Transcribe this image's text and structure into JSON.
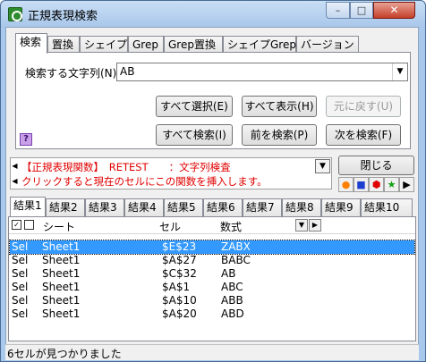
{
  "window": {
    "title": "正規表現検索",
    "minimize_glyph": "–",
    "maximize_glyph": "□",
    "close_glyph": "✕"
  },
  "tabs": [
    "検索",
    "置換",
    "シェイプ",
    "Grep",
    "Grep置換",
    "シェイプGrep",
    "バージョン"
  ],
  "search": {
    "label": "検索する文字列(N)",
    "value": "AB"
  },
  "buttons": {
    "select_all": "すべて選択(E)",
    "show_all": "すべて表示(H)",
    "undo": "元に戻す(U)",
    "search_all": "すべて検索(I)",
    "search_prev": "前を検索(P)",
    "search_next": "次を検索(F)",
    "close": "閉じる"
  },
  "help_icon": "?",
  "function_hint": {
    "line1": "【正規表現関数】　RETEST　　：文字列検査",
    "line2": "クリックすると現在のセルにこの関数を挿入します。"
  },
  "shape_icons": [
    "orange-circle-icon",
    "blue-square-icon",
    "red-hexagon-icon",
    "green-star-icon",
    "play-icon"
  ],
  "result_tabs": [
    "結果1",
    "結果2",
    "結果3",
    "結果4",
    "結果5",
    "結果6",
    "結果7",
    "結果8",
    "結果9",
    "結果10"
  ],
  "results": {
    "columns": [
      "シート",
      "セル",
      "数式"
    ],
    "rows": [
      {
        "sel": "Sel",
        "sheet": "Sheet1",
        "cell": "$E$23",
        "formula": "ZABX"
      },
      {
        "sel": "Sel",
        "sheet": "Sheet1",
        "cell": "$A$27",
        "formula": "BABC"
      },
      {
        "sel": "Sel",
        "sheet": "Sheet1",
        "cell": "$C$32",
        "formula": "AB"
      },
      {
        "sel": "Sel",
        "sheet": "Sheet1",
        "cell": "$A$1",
        "formula": "ABC"
      },
      {
        "sel": "Sel",
        "sheet": "Sheet1",
        "cell": "$A$10",
        "formula": "ABB"
      },
      {
        "sel": "Sel",
        "sheet": "Sheet1",
        "cell": "$A$20",
        "formula": "ABD"
      }
    ]
  },
  "status": "6セルが見つかりました",
  "colors": {
    "selection": "#3399ff",
    "hint_text": "#e00000"
  }
}
